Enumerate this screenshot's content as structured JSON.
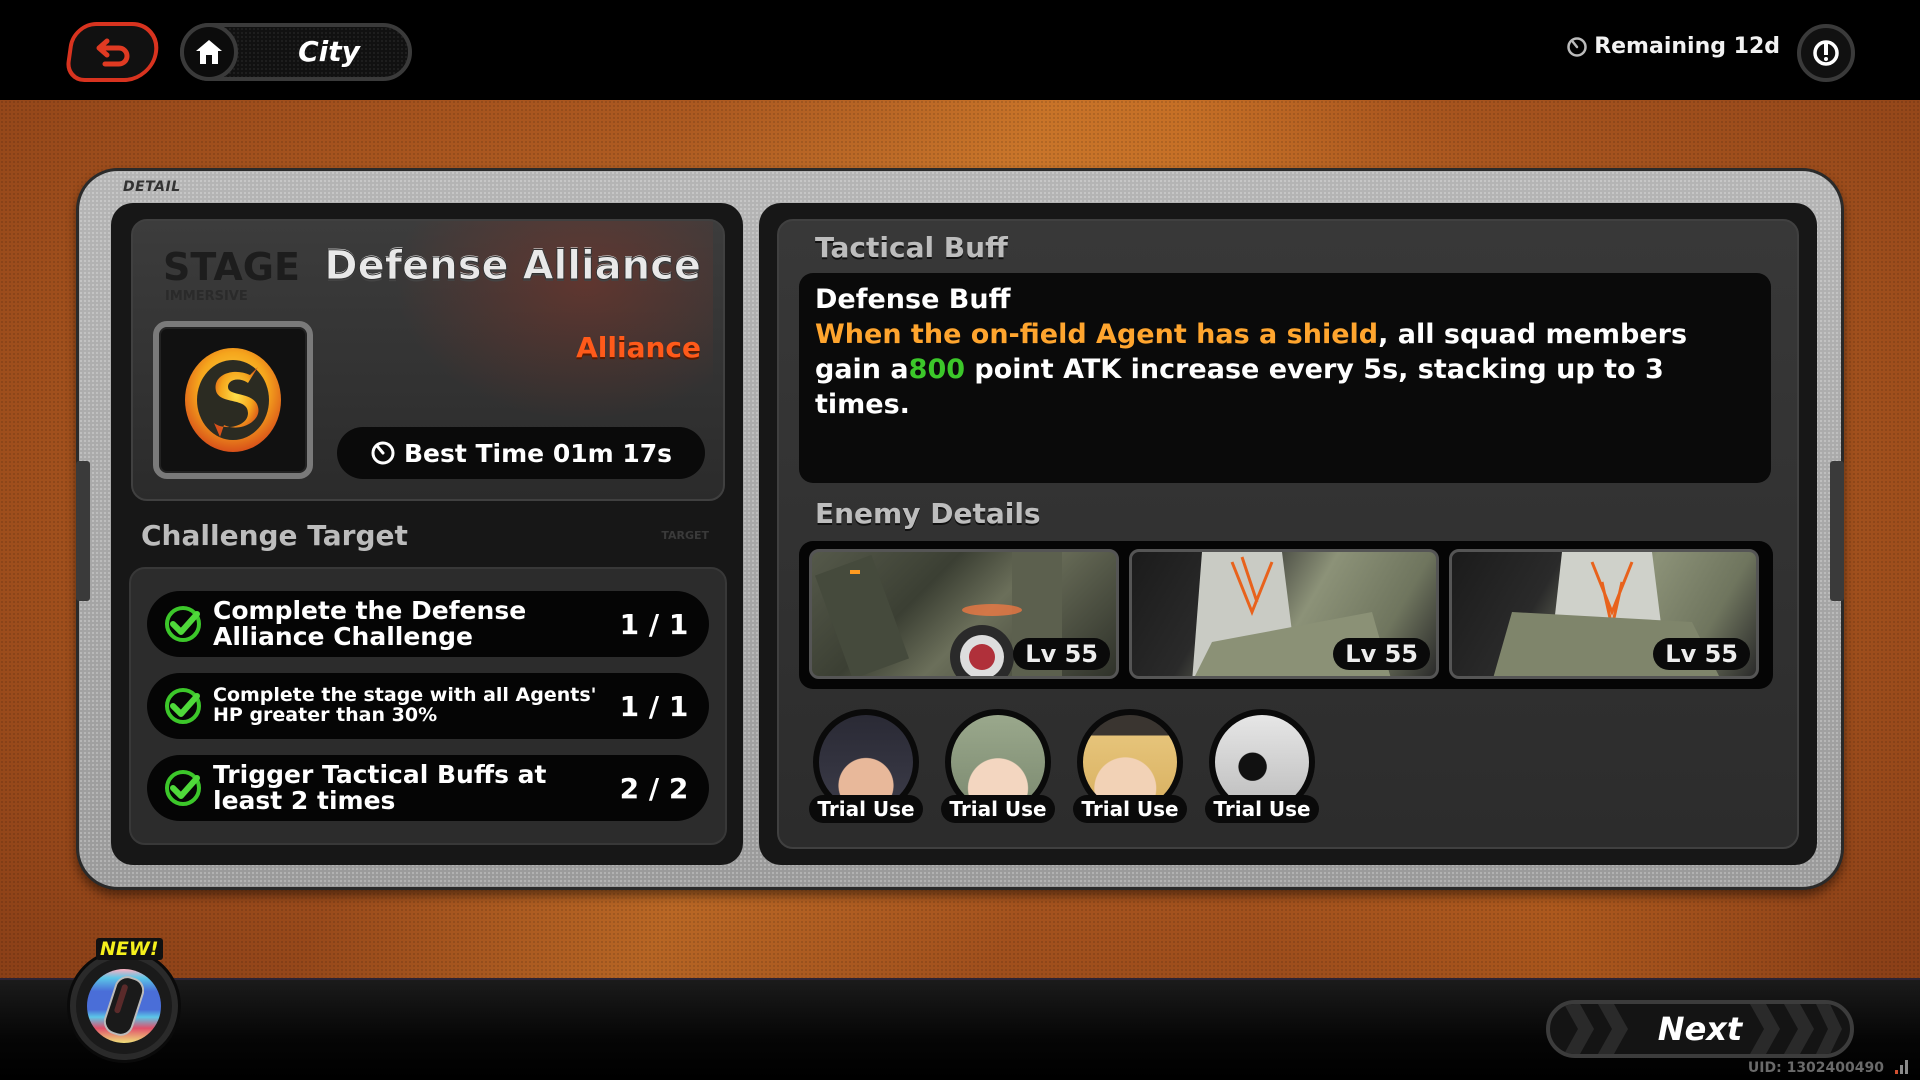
{
  "topbar": {
    "back_icon": "back-arrow-icon",
    "home_icon": "home-icon",
    "location_label": "City",
    "remaining_icon": "clock-icon",
    "remaining_text": "Remaining 12d",
    "power_icon": "power-icon"
  },
  "frame": {
    "label": "DETAIL"
  },
  "stage": {
    "heading": "STAGE",
    "subheading": "IMMERSIVE",
    "title": "Defense Alliance",
    "type": "Alliance",
    "icon": "faction-s-emblem-icon",
    "best_time_icon": "clock-icon",
    "best_time": "Best Time 01m 17s"
  },
  "challenge": {
    "title": "Challenge Target",
    "tag": "TARGET",
    "items": [
      {
        "text": "Complete the Defense Alliance Challenge",
        "progress": "1 / 1",
        "completed": true
      },
      {
        "text": "Complete the stage with all Agents' HP greater than 30%",
        "progress": "1 / 1",
        "completed": true
      },
      {
        "text": "Trigger Tactical Buffs at least 2 times",
        "progress": "2 / 2",
        "completed": true
      }
    ]
  },
  "tactical_buff": {
    "title": "Tactical Buff",
    "name": "Defense Buff",
    "desc_highlight": "When the on-field Agent has a shield",
    "desc_part1": ", all squad members gain a",
    "desc_value": "800",
    "desc_part2": " point ATK increase every 5s, stacking up to 3 times.",
    "highlight_color": "#ffa52e",
    "value_color": "#3cc72a"
  },
  "enemies": {
    "title": "Enemy Details",
    "items": [
      {
        "name": "mech-enemy",
        "level": "Lv 55"
      },
      {
        "name": "masked-soldier-enemy",
        "level": "Lv 55"
      },
      {
        "name": "masked-soldier-enemy",
        "level": "Lv 55"
      }
    ]
  },
  "trial_agents": [
    {
      "name": "agent-dark-hair",
      "label": "Trial Use"
    },
    {
      "name": "agent-green-hair",
      "label": "Trial Use"
    },
    {
      "name": "agent-blonde-cap",
      "label": "Trial Use"
    },
    {
      "name": "agent-bangboo",
      "label": "Trial Use"
    }
  ],
  "bottom": {
    "new_badge": "NEW!",
    "next_label": "Next",
    "uid": "UID: 1302400490"
  },
  "colors": {
    "accent_red": "#d8331f",
    "alliance_orange": "#ff5a1a",
    "check_green": "#3cc72a",
    "new_yellow": "#f5f01c"
  }
}
